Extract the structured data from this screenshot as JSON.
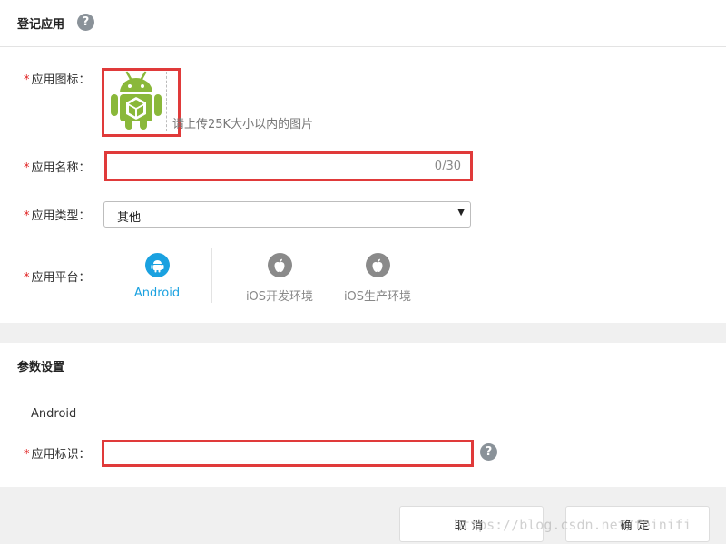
{
  "section1": {
    "title": "登记应用",
    "help": "?"
  },
  "icon_row": {
    "label": "应用图标：",
    "required_mark": "*",
    "hint": "请上传25K大小以内的图片"
  },
  "name_row": {
    "label": "应用名称：",
    "required_mark": "*",
    "value": "",
    "counter": "0/30"
  },
  "type_row": {
    "label": "应用类型：",
    "required_mark": "*",
    "selected": "其他"
  },
  "platform_row": {
    "label": "应用平台：",
    "required_mark": "*",
    "platforms": [
      {
        "label": "Android",
        "icon": "android-icon",
        "selected": true
      },
      {
        "label": "iOS开发环境",
        "icon": "apple-icon",
        "selected": false
      },
      {
        "label": "iOS生产环境",
        "icon": "apple-icon",
        "selected": false
      }
    ]
  },
  "section2": {
    "title": "参数设置",
    "subtitle": "Android"
  },
  "id_row": {
    "label": "应用标识：",
    "required_mark": "*",
    "value": "",
    "help": "?"
  },
  "footer": {
    "cancel_label": "取消",
    "ok_label": "确定"
  },
  "watermark": "https://blog.csdn.net/feinifi",
  "colors": {
    "accent": "#1aa1e0",
    "highlight": "#e03a3a",
    "android_green": "#8ab83a",
    "muted_icon": "#8a8a8a"
  }
}
